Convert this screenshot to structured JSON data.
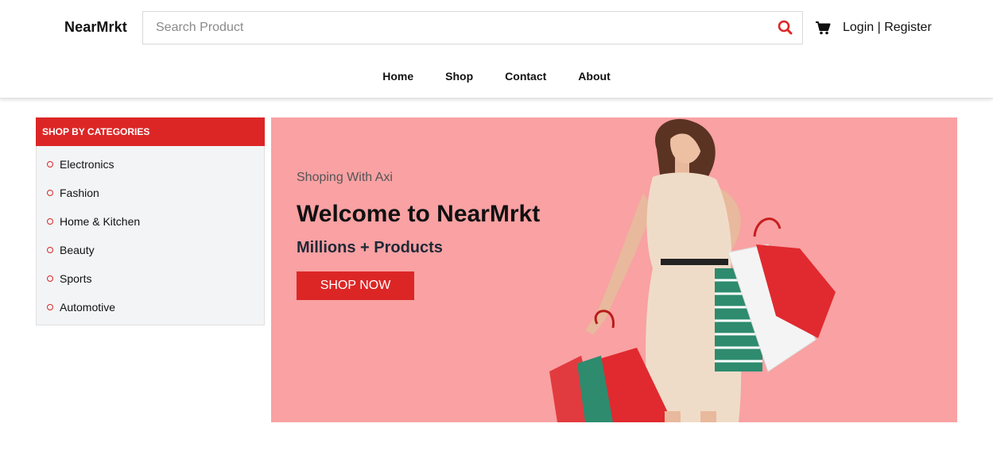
{
  "header": {
    "logo": "NearMrkt",
    "search": {
      "placeholder": "Search Product",
      "value": ""
    },
    "search_icon": "search-icon",
    "cart_icon": "cart-icon",
    "login_label": "Login",
    "separator": " | ",
    "register_label": "Register"
  },
  "nav": {
    "items": [
      {
        "label": "Home"
      },
      {
        "label": "Shop"
      },
      {
        "label": "Contact"
      },
      {
        "label": "About"
      }
    ]
  },
  "sidebar": {
    "title": "SHOP BY CATEGORIES",
    "items": [
      {
        "label": "Electronics"
      },
      {
        "label": "Fashion"
      },
      {
        "label": "Home & Kitchen"
      },
      {
        "label": "Beauty"
      },
      {
        "label": "Sports"
      },
      {
        "label": "Automotive"
      }
    ]
  },
  "banner": {
    "subtitle": "Shoping With Axi",
    "title": "Welcome to NearMrkt",
    "tagline": "Millions + Products",
    "cta_label": "SHOP NOW"
  },
  "colors": {
    "accent": "#dc2626",
    "banner_bg": "#f9a1a3",
    "sidebar_bg": "#f3f4f6"
  }
}
